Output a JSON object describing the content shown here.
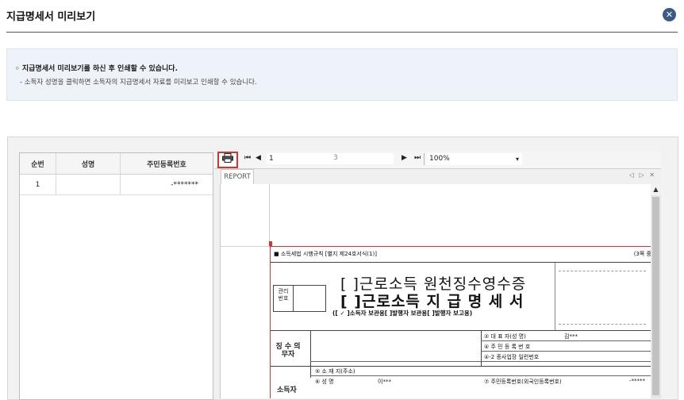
{
  "dialog": {
    "title": "지급명세서 미리보기",
    "close_label": "✕"
  },
  "notice": {
    "line1": "◦ 지급명세서 미리보기를 하신 후 인쇄할 수 있습니다.",
    "line2": "- 소득자 성명을 클릭하면 소득자의 지급명세서 자료를 미리보고 인쇄할 수 있습니다."
  },
  "grid": {
    "headers": [
      "순번",
      "성명",
      "주민등록번호"
    ],
    "rows": [
      {
        "no": "1",
        "name": "",
        "rrn": "-*******"
      }
    ]
  },
  "viewer": {
    "print_icon": "printer-icon",
    "first_icon": "⏮",
    "prev_icon": "◀",
    "current_page": "1",
    "total_pages": "3",
    "next_icon": "▶",
    "last_icon": "⏭",
    "zoom": "100%",
    "zoom_arrow": "▾",
    "tab_label": "REPORT",
    "tab_nav": "◁ ▷ ✕",
    "scroll_up": "▲"
  },
  "form": {
    "header_left": "■ 소득세법 시행규칙 [별지 제24호서식(1)]",
    "header_right": "(3쪽 중",
    "mgmt_label": "관리 번호",
    "title1": "[ ]근로소득 원천징수영수증",
    "title2": "[ ]근로소득 지 급 명 세 서",
    "subtitle": "([ ✓ ]소득자 보관용[   ]발행자 보관용[   ]발행자 보고용)",
    "withholder_label": "징 수 의무자",
    "field_rep": "② 대 표 자(성  명)",
    "field_rep_value": "김***",
    "field_corp_no": "④ 주 민 등 록 번 호",
    "field_branch": "④-2 종사업장 일련번호",
    "field_address": "⑤ 소 재 지(주소)",
    "field_name": "⑥ 성      명",
    "field_name_value": "이***",
    "field_rrn": "⑦ 주민등록번호(외국인등록번호)",
    "field_rrn_value": "-*****",
    "recipient_label": "소득자"
  }
}
